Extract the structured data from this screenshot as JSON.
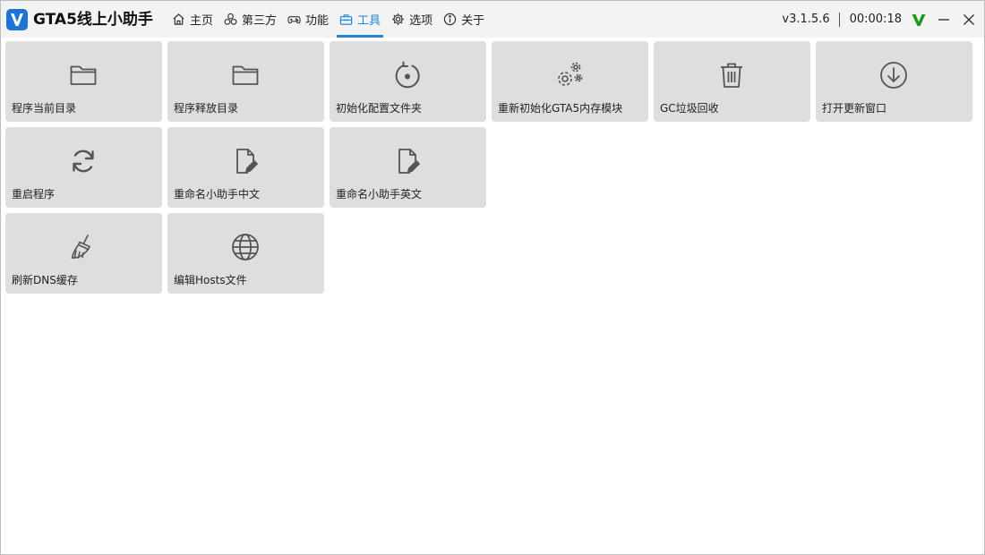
{
  "app": {
    "title": "GTA5线上小助手",
    "logo_icon": "v-logo-icon",
    "accent_color": "#1f86d8"
  },
  "nav": {
    "tabs": [
      {
        "label": "主页",
        "icon": "home-icon",
        "active": false
      },
      {
        "label": "第三方",
        "icon": "three-circles-icon",
        "active": false
      },
      {
        "label": "功能",
        "icon": "gamepad-icon",
        "active": false
      },
      {
        "label": "工具",
        "icon": "toolbox-icon",
        "active": true
      },
      {
        "label": "选项",
        "icon": "gear-icon",
        "active": false
      },
      {
        "label": "关于",
        "icon": "info-icon",
        "active": false
      }
    ]
  },
  "status": {
    "version": "v3.1.5.6",
    "timer": "00:00:18",
    "status_icon": "green-v-check-icon",
    "status_color": "#1a9a1a"
  },
  "tools": {
    "items": [
      {
        "label": "程序当前目录",
        "icon": "folder-icon"
      },
      {
        "label": "程序释放目录",
        "icon": "folder-icon"
      },
      {
        "label": "初始化配置文件夹",
        "icon": "reset-circle-icon"
      },
      {
        "label": "重新初始化GTA5内存模块",
        "icon": "gears-icon"
      },
      {
        "label": "GC垃圾回收",
        "icon": "trash-icon"
      },
      {
        "label": "打开更新窗口",
        "icon": "download-circle-icon"
      },
      {
        "label": "重启程序",
        "icon": "refresh-icon"
      },
      {
        "label": "重命名小助手中文",
        "icon": "file-edit-icon"
      },
      {
        "label": "重命名小助手英文",
        "icon": "file-edit-icon"
      },
      {
        "label": "刷新DNS缓存",
        "icon": "broom-icon"
      },
      {
        "label": "编辑Hosts文件",
        "icon": "globe-icon"
      }
    ]
  }
}
